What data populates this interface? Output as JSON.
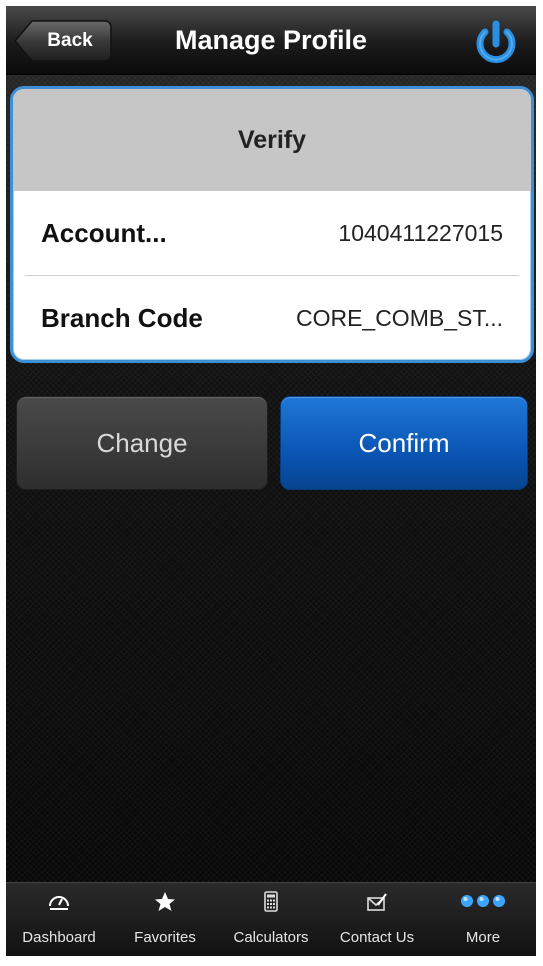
{
  "navbar": {
    "back_label": "Back",
    "title": "Manage Profile",
    "power_icon": "power-icon"
  },
  "verify": {
    "header": "Verify",
    "rows": [
      {
        "label": "Account...",
        "value": "1040411227015"
      },
      {
        "label": "Branch Code",
        "value": "CORE_COMB_ST..."
      }
    ]
  },
  "actions": {
    "change_label": "Change",
    "confirm_label": "Confirm"
  },
  "tabbar": {
    "items": [
      {
        "label": "Dashboard",
        "icon": "dashboard-icon"
      },
      {
        "label": "Favorites",
        "icon": "star-icon"
      },
      {
        "label": "Calculators",
        "icon": "calculator-icon"
      },
      {
        "label": "Contact Us",
        "icon": "contact-icon"
      },
      {
        "label": "More",
        "icon": "more-icon"
      }
    ]
  },
  "colors": {
    "accent": "#3d8fd6",
    "confirm": "#0a55b4",
    "power": "#2a8fe0"
  }
}
